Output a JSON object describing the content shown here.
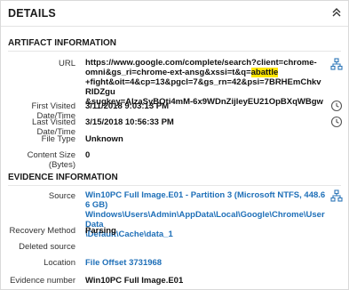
{
  "header": {
    "title": "DETAILS"
  },
  "artifact": {
    "section_title": "ARTIFACT INFORMATION",
    "url_label": "URL",
    "url_lines": [
      "https://www.google.com/complete/search?client=chrome-",
      "omni&gs_ri=chrome-ext-ansg&xssi=t&q=",
      "+fight&oit=4&cp=13&pgcl=7&gs_rn=42&psi=7BRHEmChkvRIDZgu",
      "&sugkey=AIzaSyBOti4mM-6x9WDnZijleyEU21OpBXqWBgw"
    ],
    "url_highlight": "abattle",
    "first_visited_label": "First Visited Date/Time",
    "first_visited_value": "3/11/2018 9:03:13 PM",
    "last_visited_label": "Last Visited Date/Time",
    "last_visited_value": "3/15/2018 10:56:33 PM",
    "file_type_label": "File Type",
    "file_type_value": "Unknown",
    "content_size_label": "Content Size (Bytes)",
    "content_size_value": "0"
  },
  "evidence": {
    "section_title": "EVIDENCE INFORMATION",
    "source_label": "Source",
    "source_lines": [
      "Win10PC Full Image.E01 - Partition 3 (Microsoft NTFS, 448.66 GB)",
      "Windows\\Users\\Admin\\AppData\\Local\\Google\\Chrome\\User Data",
      "\\Default\\Cache\\data_1"
    ],
    "recovery_method_label": "Recovery Method",
    "recovery_method_value": "Parsing",
    "deleted_source_label": "Deleted source",
    "deleted_source_value": "",
    "location_label": "Location",
    "location_value": "File Offset 3731968",
    "evidence_number_label": "Evidence number",
    "evidence_number_value": "Win10PC Full Image.E01"
  },
  "icons": {
    "collapse": "double-chevron-up-icon",
    "hierarchy": "hierarchy-icon",
    "timeline": "clock-icon"
  },
  "colors": {
    "link": "#1e6fb8",
    "highlight": "#ffe600",
    "icon": "#2e77b8"
  }
}
